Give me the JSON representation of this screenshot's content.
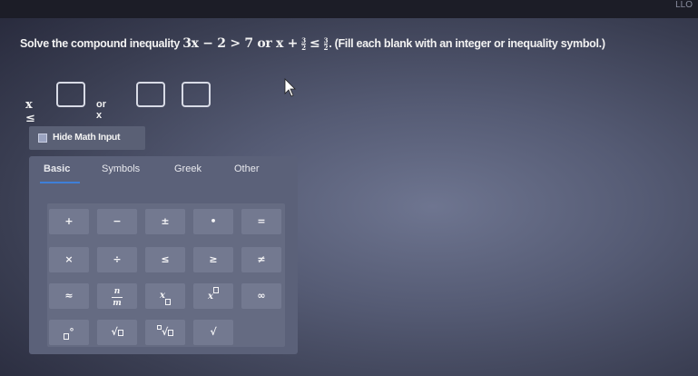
{
  "corner_text": "LLO",
  "question": {
    "prefix": "Solve the compound inequality",
    "math_1": "3x − 2 > 7 or x +",
    "frac1_num": "3",
    "frac1_den": "2",
    "math_2": "≤",
    "frac2_num": "3",
    "frac2_den": "2",
    "suffix": ". (Fill each blank with an integer or inequality symbol.)"
  },
  "answer": {
    "var1": "x ≤",
    "or_label": "or x"
  },
  "hide_math_input": "Hide Math Input",
  "tabs": [
    "Basic",
    "Symbols",
    "Greek",
    "Other"
  ],
  "keys": {
    "plus": "+",
    "minus": "−",
    "plus_minus": "±",
    "dot": "•",
    "equals": "=",
    "times": "×",
    "divide": "÷",
    "le": "≤",
    "ge": "≥",
    "ne": "≠",
    "approx": "≈",
    "frac_n": "n",
    "frac_m": "m",
    "infinity": "∞",
    "degree": "°",
    "sqrt": "√",
    "root": "√"
  },
  "colors": {
    "accent": "#3f7fd8",
    "panel": "#5b6179",
    "key": "#737990"
  }
}
